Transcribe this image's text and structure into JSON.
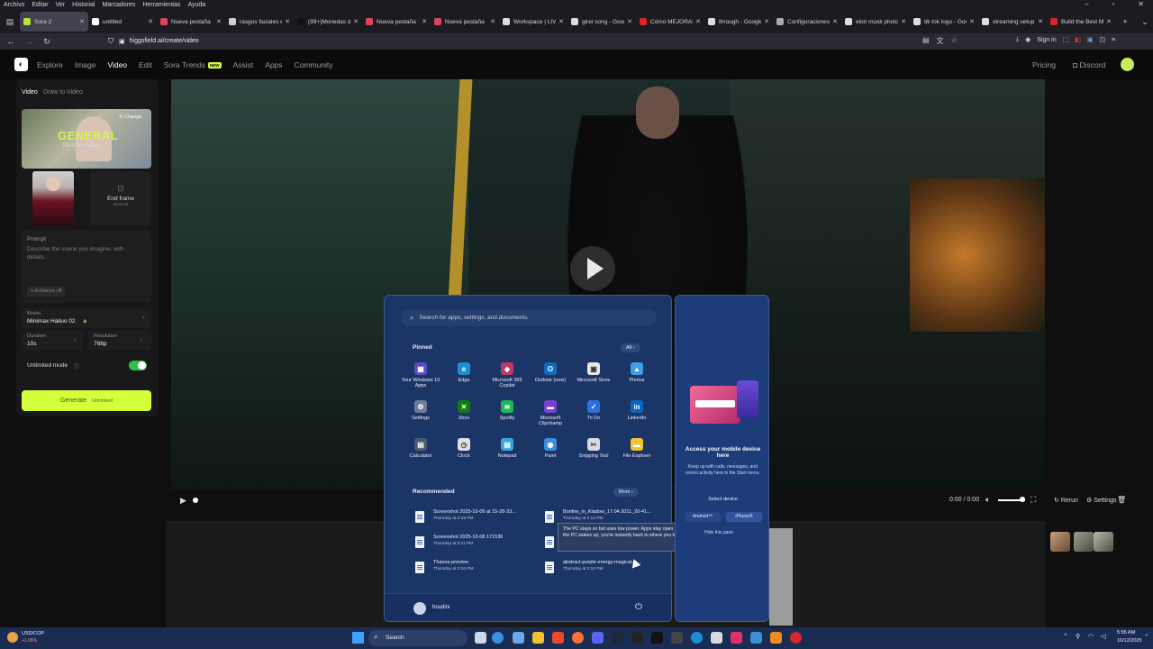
{
  "browser": {
    "menubar": [
      "Archivo",
      "Editar",
      "Ver",
      "Historial",
      "Marcadores",
      "Herramientas",
      "Ayuda"
    ],
    "tabs": [
      {
        "title": "Sora 2",
        "color": "#b9e43c",
        "active": true
      },
      {
        "title": "untitled",
        "color": "#ffffff"
      },
      {
        "title": "Nueva pestaña",
        "color": "#e0445b"
      },
      {
        "title": "rasgos faciales en",
        "color": "#cfcfcf"
      },
      {
        "title": "(99+)Monedas de",
        "color": "#111111"
      },
      {
        "title": "Nueva pestaña",
        "color": "#e0445b"
      },
      {
        "title": "Nueva pestaña",
        "color": "#e0445b"
      },
      {
        "title": "Workspace | LIVE",
        "color": "#dddddd"
      },
      {
        "title": "girei song - Goog",
        "color": "#dddddd"
      },
      {
        "title": "Cómo MEJORAR",
        "color": "#e02424"
      },
      {
        "title": "through - Google",
        "color": "#dddddd"
      },
      {
        "title": "Configuraciones",
        "color": "#aaaaaa"
      },
      {
        "title": "elon musk photo",
        "color": "#dddddd"
      },
      {
        "title": "tik tok logo - Goo",
        "color": "#dddddd"
      },
      {
        "title": "streaming setup",
        "color": "#dddddd"
      },
      {
        "title": "Build the Best M",
        "color": "#e02424"
      }
    ],
    "url": "higgsfield.ai/create/video",
    "signin": "Sign in"
  },
  "site": {
    "nav": [
      "Explore",
      "Image",
      "Video",
      "Edit",
      "Sora Trends",
      "Assist",
      "Apps",
      "Community"
    ],
    "new_badge": "NEW",
    "pricing": "Pricing",
    "discord": "Discord"
  },
  "panel": {
    "tab_video": "Video",
    "tab_draw": "Draw to Video",
    "preset_title": "GENERAL",
    "preset_sub": "Minimax Hailuo",
    "change": "Change",
    "end_frame": "End frame",
    "optional": "Optional",
    "prompt_label": "Prompt",
    "prompt_placeholder": "Describe the scene you imagine, with details.",
    "enhance": "Enhance off",
    "model_label": "Model",
    "model_value": "Minimax Hailuo 02",
    "duration_label": "Duration",
    "duration_value": "10s",
    "resolution_label": "Resolution",
    "resolution_value": "768p",
    "unlimited_label": "Unlimited mode",
    "generate": "Generate",
    "generate_badge": "Unlimited"
  },
  "player": {
    "time": "0:00 / 0:00",
    "rerun": "Rerun",
    "settings": "Settings"
  },
  "startmenu": {
    "search_placeholder": "Search for apps, settings, and documents",
    "pinned": "Pinned",
    "all": "All",
    "apps": [
      {
        "name": "Your Windows 10 Apps",
        "color": "#5b4bc4",
        "glyph": "▦"
      },
      {
        "name": "Edge",
        "color": "#1f8dd6",
        "glyph": "e"
      },
      {
        "name": "Microsoft 365 Copilot",
        "color": "#c0386a",
        "glyph": "◆"
      },
      {
        "name": "Outlook (new)",
        "color": "#0f6cbd",
        "glyph": "O"
      },
      {
        "name": "Microsoft Store",
        "color": "#e8e8e8",
        "glyph": "▣"
      },
      {
        "name": "Photos",
        "color": "#3aa0e8",
        "glyph": "▲"
      },
      {
        "name": "Settings",
        "color": "#6d7c93",
        "glyph": "⚙"
      },
      {
        "name": "Xbox",
        "color": "#107c10",
        "glyph": "✕"
      },
      {
        "name": "Spotify",
        "color": "#1db954",
        "glyph": "≋"
      },
      {
        "name": "Microsoft Clipchamp",
        "color": "#7d3fd0",
        "glyph": "▬"
      },
      {
        "name": "To Do",
        "color": "#2e6fd9",
        "glyph": "✓"
      },
      {
        "name": "LinkedIn",
        "color": "#0a66c2",
        "glyph": "in"
      },
      {
        "name": "Calculator",
        "color": "#4b5a70",
        "glyph": "▤"
      },
      {
        "name": "Clock",
        "color": "#e0e0e0",
        "glyph": "◷"
      },
      {
        "name": "Notepad",
        "color": "#38a4e0",
        "glyph": "▤"
      },
      {
        "name": "Paint",
        "color": "#3a8fd8",
        "glyph": "◉"
      },
      {
        "name": "Snipping Tool",
        "color": "#d8d8e0",
        "glyph": "✂"
      },
      {
        "name": "File Explorer",
        "color": "#f2c12e",
        "glyph": "▬"
      }
    ],
    "recommended": "Recommended",
    "more": "More",
    "files": [
      {
        "name": "Screenshot 2025-10-09 at 15-28-33...",
        "time": "Thursday at 3:28 PM"
      },
      {
        "name": "Bonfire_in_Kladow_17.04.2011_20-41...",
        "time": "Thursday at 3:12 PM"
      },
      {
        "name": "Screenshot 2025-10-08 171536",
        "time": "Thursday at 3:11 PM"
      },
      {
        "name": "",
        "time": ""
      },
      {
        "name": "Thanos-preview",
        "time": "Thursday at 3:10 PM"
      },
      {
        "name": "abstract-purple-energy-magical-w...",
        "time": "Thursday at 3:10 PM"
      }
    ],
    "tooltip": "The PC stays on but uses low power. Apps stay open so when the PC wakes up, you're instantly back to where you left off.",
    "user": "houdini",
    "side_title": "Access your mobile device here",
    "side_desc": "Keep up with calls, messages, and recent activity here in the Start menu.",
    "select_device": "Select device",
    "android": "Android™",
    "iphone": "iPhone®",
    "hide_pane": "Hide this pane"
  },
  "taskbar": {
    "ticker": "USD/COP",
    "ticker_change": "+1.06%",
    "search": "Search",
    "time": "5:55 AM",
    "date": "10/12/2025"
  }
}
